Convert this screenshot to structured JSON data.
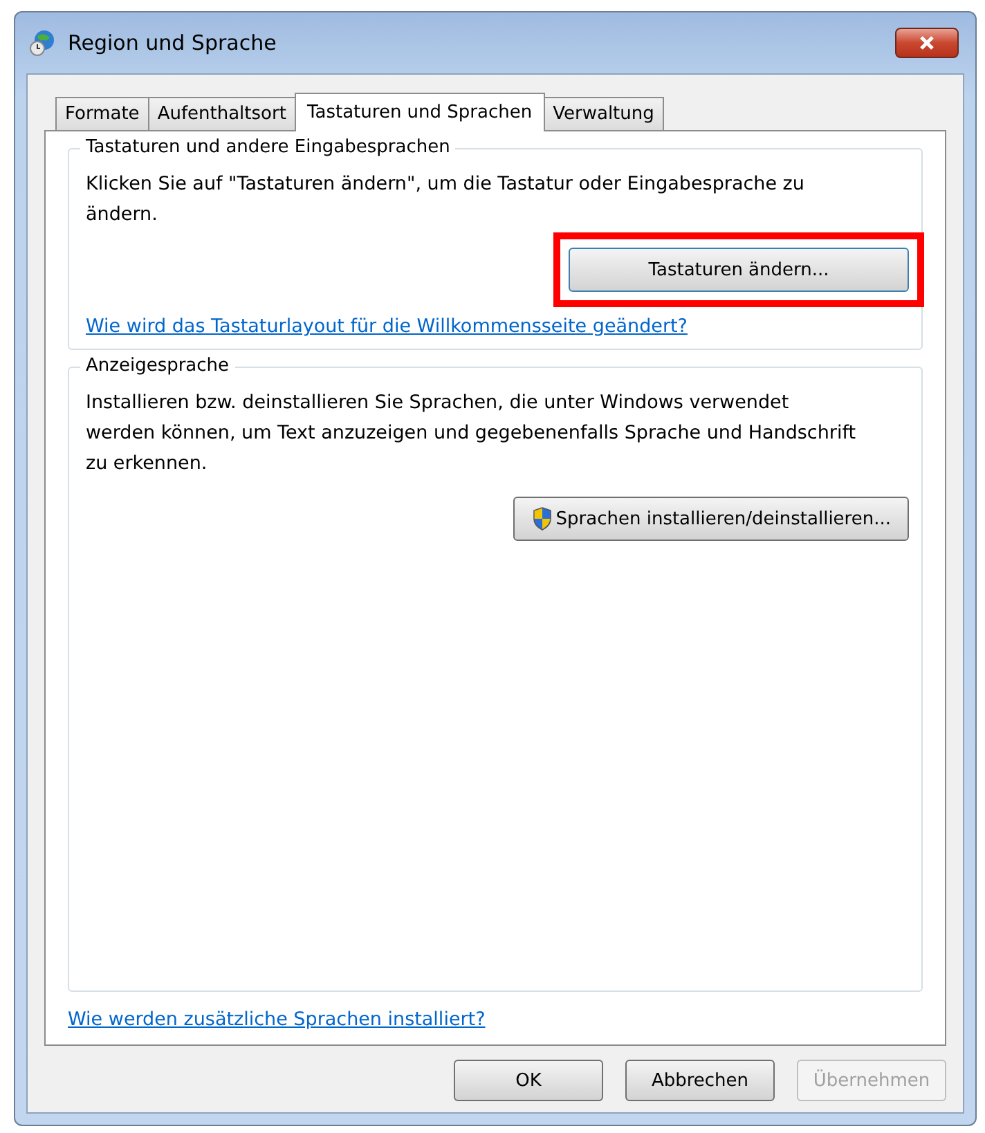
{
  "window": {
    "title": "Region und Sprache"
  },
  "tabs": [
    {
      "label": "Formate",
      "selected": false
    },
    {
      "label": "Aufenthaltsort",
      "selected": false
    },
    {
      "label": "Tastaturen und Sprachen",
      "selected": true
    },
    {
      "label": "Verwaltung",
      "selected": false
    }
  ],
  "groups": [
    {
      "title": "Tastaturen und andere Eingabesprachen",
      "text": "Klicken Sie auf \"Tastaturen ändern\", um die Tastatur oder Eingabesprache zu ändern.",
      "button": {
        "label": "Tastaturen ändern...",
        "shield": false,
        "highlighted": true
      },
      "link": "Wie wird das Tastaturlayout für die Willkommensseite geändert?"
    },
    {
      "title": "Anzeigesprache",
      "text": "Installieren bzw. deinstallieren Sie Sprachen, die unter Windows verwendet werden können, um Text anzuzeigen und gegebenenfalls Sprache und Handschrift zu erkennen.",
      "button": {
        "label": "Sprachen installieren/deinstallieren...",
        "shield": true,
        "highlighted": false
      }
    }
  ],
  "footer_link": "Wie werden zusätzliche Sprachen installiert?",
  "buttons": [
    {
      "label": "OK",
      "disabled": false
    },
    {
      "label": "Abbrechen",
      "disabled": false
    },
    {
      "label": "Übernehmen",
      "disabled": true
    }
  ]
}
